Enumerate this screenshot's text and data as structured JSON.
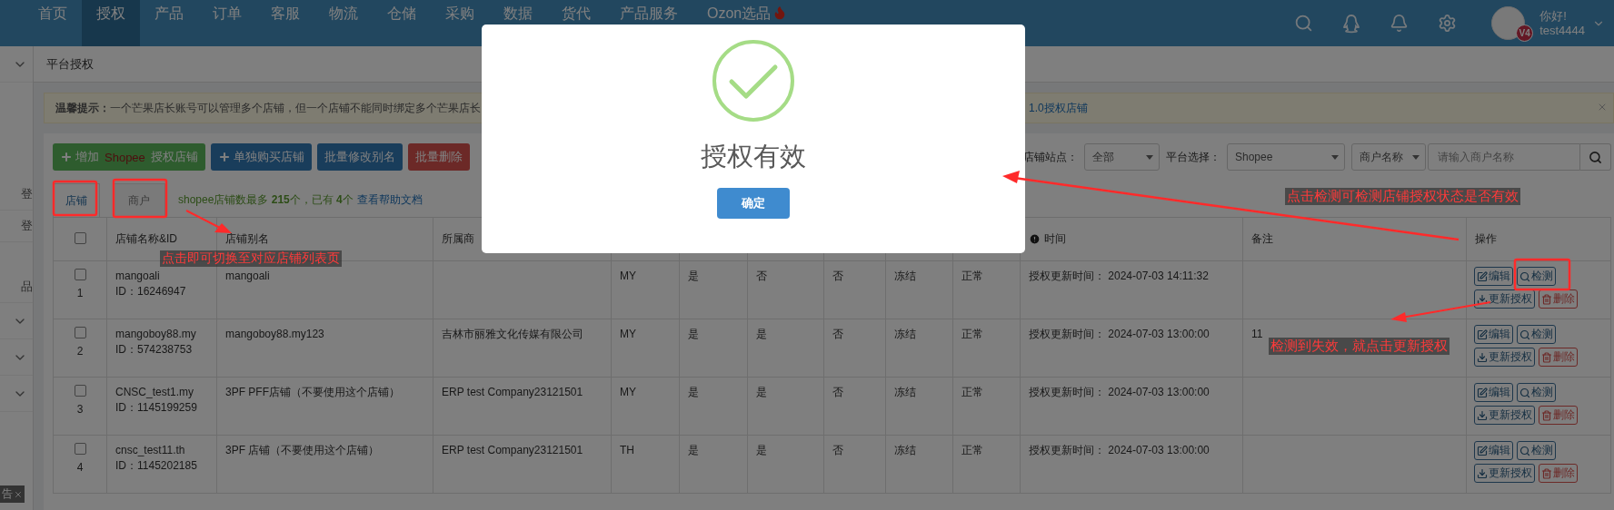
{
  "nav": {
    "items": [
      {
        "label": "首页",
        "selected": false
      },
      {
        "label": "授权",
        "selected": true
      },
      {
        "label": "产品",
        "selected": false
      },
      {
        "label": "订单",
        "selected": false
      },
      {
        "label": "客服",
        "selected": false
      },
      {
        "label": "物流",
        "selected": false
      },
      {
        "label": "仓储",
        "selected": false
      },
      {
        "label": "采购",
        "selected": false
      },
      {
        "label": "数据",
        "selected": false
      },
      {
        "label": "货代",
        "selected": false
      },
      {
        "label": "产品服务",
        "selected": false
      },
      {
        "label": "Ozon选品",
        "selected": false,
        "hot": true
      }
    ],
    "user": {
      "greeting": "你好!",
      "name": "test4444",
      "badge": "V4"
    }
  },
  "sidebar": {
    "items": [
      {
        "kind": "group"
      },
      {
        "kind": "link",
        "label": "登"
      },
      {
        "kind": "link",
        "label": "登"
      },
      {
        "kind": "link",
        "label": "品"
      },
      {
        "kind": "group"
      },
      {
        "kind": "group"
      },
      {
        "kind": "group"
      }
    ],
    "ad_tag": "告"
  },
  "breadcrumb": "平台授权",
  "notice": {
    "label": "温馨提示：",
    "text": "一个芒果店长账号可以管理多个店铺，但一个店铺不能同时绑定多个芒果店长",
    "link": "1.0授权店铺"
  },
  "toolbar": {
    "buttons": [
      {
        "kind": "add",
        "label": "增加",
        "brand": "Shopee",
        "suffix": "授权店铺"
      },
      {
        "kind": "buy",
        "label": "单独购买店铺"
      },
      {
        "kind": "rename",
        "label": "批量修改别名"
      },
      {
        "kind": "delete",
        "label": "批量删除"
      }
    ],
    "filters": {
      "site_label": "店铺站点：",
      "site": "全部",
      "platform_label": "平台选择：",
      "platform": "Shopee",
      "field": "商户名称",
      "placeholder": "请输入商户名称"
    }
  },
  "tabs": [
    {
      "label": "店铺",
      "selected": true
    },
    {
      "label": "商户",
      "selected": false
    }
  ],
  "info": {
    "text": "shopee店铺数最多 **215**个，已有 **4**个",
    "link": "查看帮助文档"
  },
  "table": {
    "select_all": {
      "checked": false
    },
    "header": {
      "name": "店铺名称&ID",
      "alias": "店铺别名",
      "merchant": "所属商",
      "time": "时间",
      "remark": "备注",
      "actions": "操作"
    },
    "rows": [
      {
        "number": "1",
        "checked": false,
        "name": "mangoali",
        "id": "ID：16246947",
        "alias": "mangoali",
        "site": "MY",
        "col_6": "是",
        "col_7": "否",
        "col_8": "否",
        "col_9": "冻结",
        "col_10": "正常",
        "time": "授权更新时间： 2024-07-03 14:11:32",
        "actions": [
          {
            "kind": "edit",
            "label": "编辑"
          },
          {
            "kind": "check",
            "label": "检测"
          },
          {
            "kind": "renew",
            "label": "更新授权"
          },
          {
            "kind": "delete",
            "label": "删除"
          }
        ]
      },
      {
        "number": "2",
        "checked": false,
        "name": "mangoboy88.my",
        "id": "ID：574238753",
        "alias": "mangoboy88.my123",
        "merchant": "吉林市丽雅文化传媒有限公司",
        "site": "MY",
        "col_6": "是",
        "col_7": "是",
        "col_8": "否",
        "col_9": "冻结",
        "col_10": "正常",
        "time": "授权更新时间： 2024-07-03 13:00:00",
        "remark": "11",
        "actions": [
          {
            "kind": "edit",
            "label": "编辑"
          },
          {
            "kind": "check",
            "label": "检测"
          },
          {
            "kind": "renew",
            "label": "更新授权"
          },
          {
            "kind": "delete",
            "label": "删除"
          }
        ]
      },
      {
        "number": "3",
        "checked": false,
        "name": "CNSC_test1.my",
        "id": "ID：1145199259",
        "alias": "3PF PFF店铺（不要使用这个店铺）",
        "merchant": "ERP test Company23121501",
        "site": "MY",
        "col_6": "是",
        "col_7": "是",
        "col_8": "否",
        "col_9": "冻结",
        "col_10": "正常",
        "time": "授权更新时间： 2024-07-03 13:00:00",
        "actions": [
          {
            "kind": "edit",
            "label": "编辑"
          },
          {
            "kind": "check",
            "label": "检测"
          },
          {
            "kind": "renew",
            "label": "更新授权"
          },
          {
            "kind": "delete",
            "label": "删除"
          }
        ]
      },
      {
        "number": "4",
        "checked": false,
        "name": "cnsc_test11.th",
        "id": "ID：1145202185",
        "alias": "3PF 店铺（不要使用这个店铺）",
        "merchant": "ERP test Company23121501",
        "site": "TH",
        "col_6": "是",
        "col_7": "是",
        "col_8": "否",
        "col_9": "冻结",
        "col_10": "正常",
        "time": "授权更新时间： 2024-07-03 13:00:00",
        "actions": [
          {
            "kind": "edit",
            "label": "编辑"
          },
          {
            "kind": "check",
            "label": "检测"
          },
          {
            "kind": "renew",
            "label": "更新授权"
          },
          {
            "kind": "delete",
            "label": "删除"
          }
        ]
      }
    ]
  },
  "modal": {
    "title": "授权有效",
    "button": "确定"
  },
  "annotations": {
    "tab_note": "点击即可切换至对应店铺列表页",
    "check_note": "点击检测可检测店铺授权状态是否有效",
    "renew_note": "检测到失效，就点击更新授权"
  }
}
